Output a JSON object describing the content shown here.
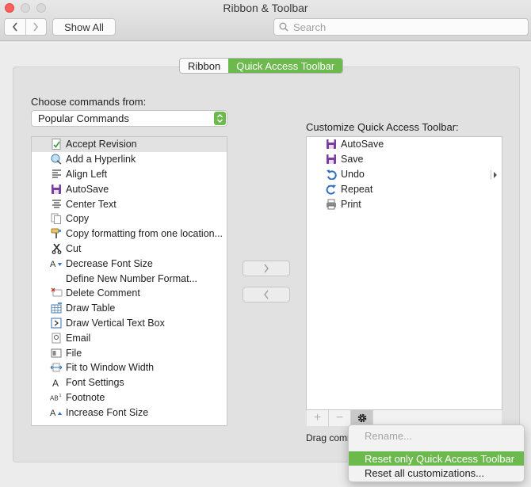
{
  "window": {
    "title": "Ribbon & Toolbar"
  },
  "toolbar": {
    "show_all": "Show All",
    "search_placeholder": "Search"
  },
  "tabs": [
    {
      "label": "Ribbon",
      "active": false
    },
    {
      "label": "Quick Access Toolbar",
      "active": true
    }
  ],
  "left": {
    "label": "Choose commands from:",
    "popup_value": "Popular Commands",
    "commands": [
      {
        "label": "Accept Revision",
        "icon": "accept-revision-icon",
        "selected": true
      },
      {
        "label": "Add a Hyperlink",
        "icon": "hyperlink-icon"
      },
      {
        "label": "Align Left",
        "icon": "align-left-icon"
      },
      {
        "label": "AutoSave",
        "icon": "autosave-icon"
      },
      {
        "label": "Center Text",
        "icon": "center-text-icon"
      },
      {
        "label": "Copy",
        "icon": "copy-icon"
      },
      {
        "label": "Copy formatting from one location...",
        "icon": "format-painter-icon"
      },
      {
        "label": "Cut",
        "icon": "cut-icon"
      },
      {
        "label": "Decrease Font Size",
        "icon": "decrease-font-size-icon"
      },
      {
        "label": "Define New Number Format...",
        "icon": ""
      },
      {
        "label": "Delete Comment",
        "icon": "delete-comment-icon"
      },
      {
        "label": "Draw Table",
        "icon": "draw-table-icon"
      },
      {
        "label": "Draw Vertical Text Box",
        "icon": "vertical-text-box-icon"
      },
      {
        "label": "Email",
        "icon": "email-icon"
      },
      {
        "label": "File",
        "icon": "file-icon"
      },
      {
        "label": "Fit to Window Width",
        "icon": "fit-width-icon"
      },
      {
        "label": "Font Settings",
        "icon": "font-settings-icon"
      },
      {
        "label": "Footnote",
        "icon": "footnote-icon"
      },
      {
        "label": "Increase Font Size",
        "icon": "increase-font-size-icon"
      }
    ]
  },
  "right": {
    "label": "Customize Quick Access Toolbar:",
    "items": [
      {
        "label": "AutoSave",
        "icon": "autosave-icon"
      },
      {
        "label": "Save",
        "icon": "save-icon"
      },
      {
        "label": "Undo",
        "icon": "undo-icon"
      },
      {
        "label": "Repeat",
        "icon": "repeat-icon"
      },
      {
        "label": "Print",
        "icon": "print-icon"
      }
    ],
    "drag_hint": "Drag comm"
  },
  "context_menu": {
    "items": [
      {
        "label": "Rename...",
        "state": "disabled"
      },
      {
        "label": "Reset only Quick Access Toolbar",
        "state": "highlighted"
      },
      {
        "label": "Reset all customizations...",
        "state": "normal"
      }
    ]
  },
  "colors": {
    "accent": "#6cb94e",
    "close": "#fc605c"
  }
}
